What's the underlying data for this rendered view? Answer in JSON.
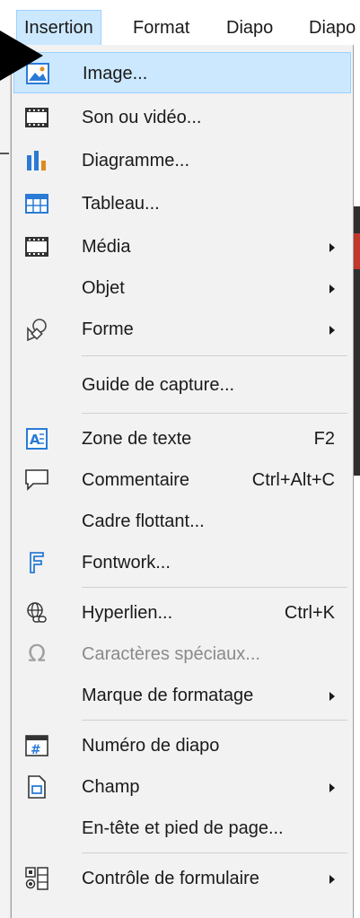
{
  "menubar": {
    "items": [
      {
        "label": "Insertion",
        "active": true
      },
      {
        "label": "Format"
      },
      {
        "label": "Diapo"
      },
      {
        "label": "Diapo"
      }
    ]
  },
  "menu": {
    "image": {
      "label": "Image...",
      "icon": "image-icon"
    },
    "son_video": {
      "label": "Son ou vidéo...",
      "icon": "film-icon"
    },
    "diagramme": {
      "label": "Diagramme...",
      "icon": "chart-icon"
    },
    "tableau": {
      "label": "Tableau...",
      "icon": "table-icon"
    },
    "media": {
      "label": "Média",
      "icon": "film-icon",
      "submenu": true
    },
    "objet": {
      "label": "Objet",
      "submenu": true
    },
    "forme": {
      "label": "Forme",
      "icon": "shapes-icon",
      "submenu": true
    },
    "guide_capture": {
      "label": "Guide de capture..."
    },
    "zone_texte": {
      "label": "Zone de texte",
      "shortcut": "F2",
      "icon": "text-box-icon"
    },
    "commentaire": {
      "label": "Commentaire",
      "shortcut": "Ctrl+Alt+C",
      "icon": "comment-icon"
    },
    "cadre_flottant": {
      "label": "Cadre flottant..."
    },
    "fontwork": {
      "label": "Fontwork...",
      "icon": "fontwork-icon"
    },
    "hyperlien": {
      "label": "Hyperlien...",
      "shortcut": "Ctrl+K",
      "icon": "hyperlink-icon"
    },
    "caracteres_speciaux": {
      "label": "Caractères spéciaux...",
      "icon": "omega-icon",
      "disabled": true
    },
    "marque_formatage": {
      "label": "Marque de formatage",
      "submenu": true
    },
    "numero_diapo": {
      "label": "Numéro de diapo",
      "icon": "slide-number-icon"
    },
    "champ": {
      "label": "Champ",
      "icon": "field-icon",
      "submenu": true
    },
    "entete_pied": {
      "label": "En-tête et pied de page..."
    },
    "controle_formulaire": {
      "label": "Contrôle de formulaire",
      "icon": "form-control-icon",
      "submenu": true
    }
  },
  "colors": {
    "highlight": "#cce8ff",
    "highlight_border": "#99d1ff",
    "menu_bg": "#f2f2f2",
    "icon_blue": "#2a7bd5",
    "icon_orange": "#e08a1e"
  }
}
